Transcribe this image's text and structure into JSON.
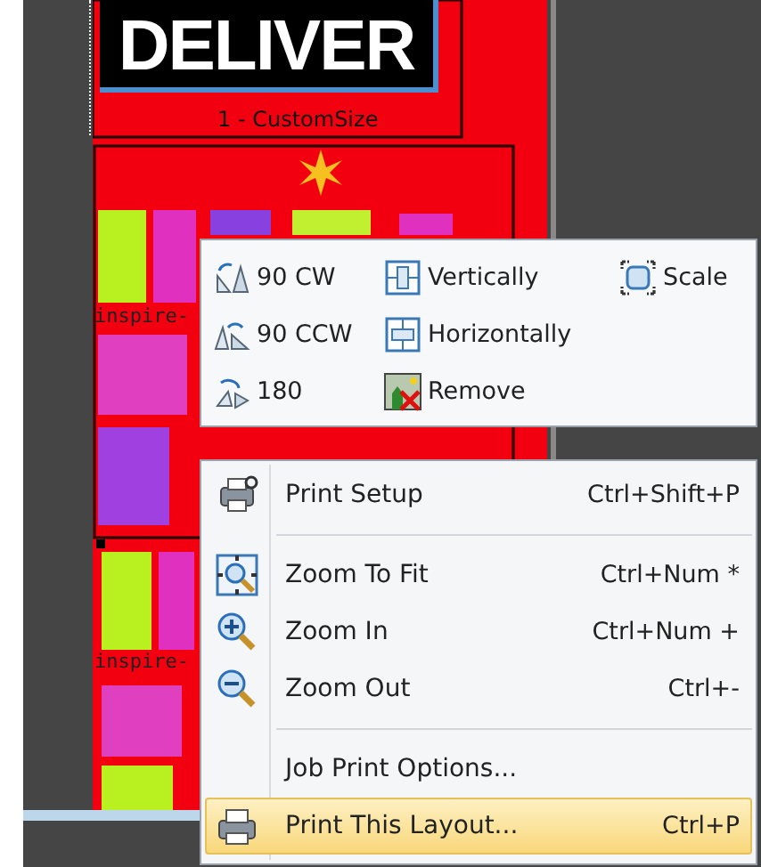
{
  "canvas": {
    "logo": "DELIVER",
    "page_label": "1 - CustomSize",
    "captions": [
      "inspire-",
      "inspire-"
    ]
  },
  "transform_panel": {
    "columns": [
      [
        {
          "label": "90 CW"
        },
        {
          "label": "90 CCW"
        },
        {
          "label": "180"
        }
      ],
      [
        {
          "label": "Vertically"
        },
        {
          "label": "Horizontally"
        },
        {
          "label": "Remove"
        }
      ],
      [
        {
          "label": "Scale"
        }
      ]
    ]
  },
  "context_menu": {
    "items": [
      {
        "kind": "item",
        "label": "Print Setup",
        "shortcut": "Ctrl+Shift+P",
        "selected": false
      },
      {
        "kind": "separator"
      },
      {
        "kind": "item",
        "label": "Zoom To Fit",
        "shortcut": "Ctrl+Num *",
        "selected": false
      },
      {
        "kind": "item",
        "label": "Zoom In",
        "shortcut": "Ctrl+Num +",
        "selected": false
      },
      {
        "kind": "item",
        "label": "Zoom Out",
        "shortcut": "Ctrl+-",
        "selected": false
      },
      {
        "kind": "separator"
      },
      {
        "kind": "item",
        "label": "Job Print Options...",
        "selected": false
      },
      {
        "kind": "item",
        "label": "Print This Layout...",
        "shortcut": "Ctrl+P",
        "selected": true
      }
    ]
  }
}
